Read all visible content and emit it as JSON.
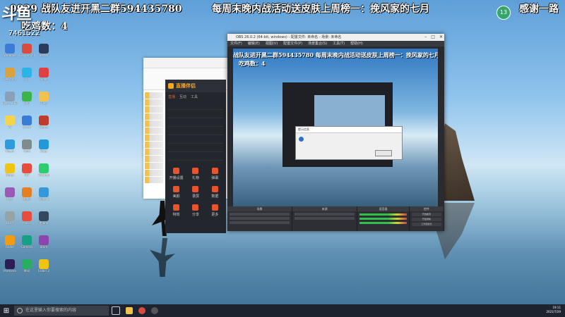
{
  "stream_overlay": {
    "ticker_segments": [
      "9929  战队友进开黑二群594435780",
      "每周末晚内战活动送皮肤上周榜一：挽风家的七月",
      "感谢一路"
    ],
    "kill_count_label": "吃鸡数：4",
    "platform_logo": "斗鱼",
    "room_number": "7461522",
    "badge_number": "13"
  },
  "desktop": {
    "icons": [
      {
        "label": "Windows",
        "color": "#3d7bd9"
      },
      {
        "label": "Google Chrome",
        "color": "#d94b3d"
      },
      {
        "label": "Steam",
        "color": "#2b3b5c"
      },
      {
        "label": "WeGame",
        "color": "#d9a23d"
      },
      {
        "label": "QQ",
        "color": "#2bb4e8"
      },
      {
        "label": "Video",
        "color": "#e04040"
      },
      {
        "label": "Recycle Bin",
        "color": "#8aa0b8"
      },
      {
        "label": "360",
        "color": "#39b54a"
      },
      {
        "label": "Files",
        "color": "#f2c14e"
      },
      {
        "label": "YY",
        "color": "#f6d34a"
      },
      {
        "label": "Arrow",
        "color": "#3a7bd5"
      },
      {
        "label": "Game",
        "color": "#c0392b"
      },
      {
        "label": "Player",
        "color": "#2d9cdb"
      },
      {
        "label": "Tools",
        "color": "#7f8c8d"
      },
      {
        "label": "Edge",
        "color": "#1f9ad6"
      },
      {
        "label": "Notes",
        "color": "#f1c40f"
      },
      {
        "label": "PDF",
        "color": "#e74c3c"
      },
      {
        "label": "WeChat",
        "color": "#2ecc71"
      },
      {
        "label": "Pets",
        "color": "#9b59b6"
      },
      {
        "label": "Media",
        "color": "#e67e22"
      },
      {
        "label": "Video 2",
        "color": "#3498db"
      },
      {
        "label": "Docs",
        "color": "#95a5a6"
      },
      {
        "label": "Music",
        "color": "#e74c3c"
      },
      {
        "label": "Phone",
        "color": "#34495e"
      },
      {
        "label": "Folder",
        "color": "#f39c12"
      },
      {
        "label": "Camera",
        "color": "#16a085"
      },
      {
        "label": "Store",
        "color": "#8e44ad"
      },
      {
        "label": "Premiere",
        "color": "#2c1e55"
      },
      {
        "label": "Mail",
        "color": "#27ae60"
      },
      {
        "label": "Folder 2",
        "color": "#f1c40f"
      }
    ]
  },
  "streaming_tool": {
    "title": "直播伴侣",
    "tabs": [
      "直播",
      "互动",
      "工具"
    ],
    "grid_items": [
      "开播设置",
      "礼物",
      "弹幕",
      "美颜",
      "录屏",
      "数据",
      "特效",
      "分享",
      "更多"
    ]
  },
  "obs": {
    "window_title": "OBS 26.0.2 (64-bit, windows) - 配置文件: 未命名 - 场景: 未命名",
    "menus": [
      "文件(F)",
      "编辑(E)",
      "视图(V)",
      "配置文件(P)",
      "场景集合(S)",
      "工具(T)",
      "帮助(H)"
    ],
    "preview_ticker": "战队友进开黑二群594435780  每周末晚内战活动送皮肤上周榜一：挽风家的七月  感谢一路",
    "preview_kills": "吃鸡数：4",
    "dialog_title": "提示信息",
    "dock_headers": [
      "场景",
      "来源",
      "混音器",
      "控件"
    ],
    "controls": [
      "开始推流",
      "开始录制",
      "工作室模式",
      "设置",
      "退出"
    ]
  },
  "taskbar": {
    "search_placeholder": "在这里输入你要搜索的内容",
    "time": "19:11",
    "date": "2021/7/29"
  }
}
